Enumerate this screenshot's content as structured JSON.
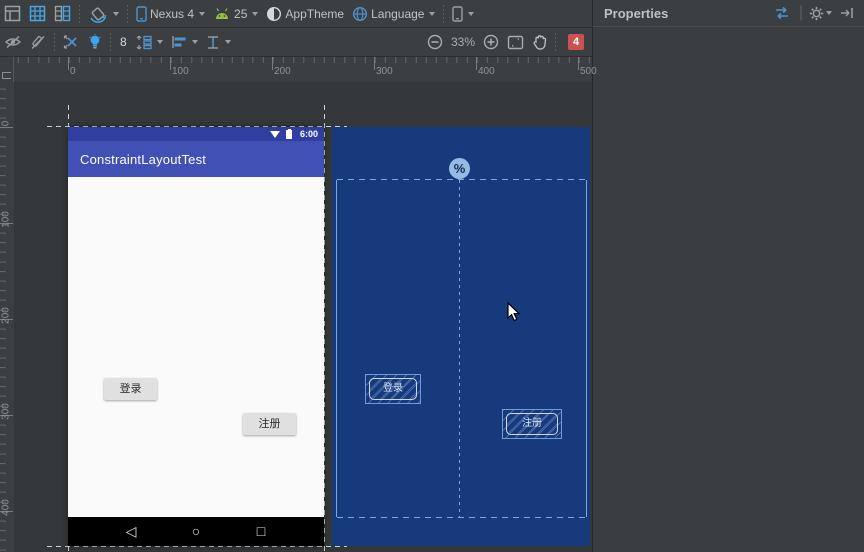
{
  "topbar": {
    "device_label": "Nexus 4",
    "api_level": "25",
    "theme_label": "AppTheme",
    "locale_label": "Language"
  },
  "toolbar": {
    "default_margin": "8",
    "zoom_level": "33%",
    "error_count": "4"
  },
  "rulers": {
    "horizontal": [
      "0",
      "100",
      "200",
      "300",
      "400",
      "500"
    ],
    "vertical": [
      "0",
      "100",
      "200",
      "300",
      "400"
    ]
  },
  "design_view": {
    "status_time": "6:00",
    "app_title": "ConstraintLayoutTest",
    "login_button": "登录",
    "register_button": "注册",
    "nav": {
      "back": "◁",
      "home": "○",
      "recents": "□"
    }
  },
  "blueprint_view": {
    "guideline_badge": "%",
    "login_button": "登录",
    "register_button": "注册"
  },
  "properties_panel": {
    "title": "Properties"
  },
  "colors": {
    "accent_blue": "#4e94ce",
    "blueprint_bg": "#173a7d",
    "blueprint_line": "#7fa8d9",
    "appbar": "#4050b5",
    "statusbar": "#303f9f",
    "error_red": "#c75450"
  }
}
